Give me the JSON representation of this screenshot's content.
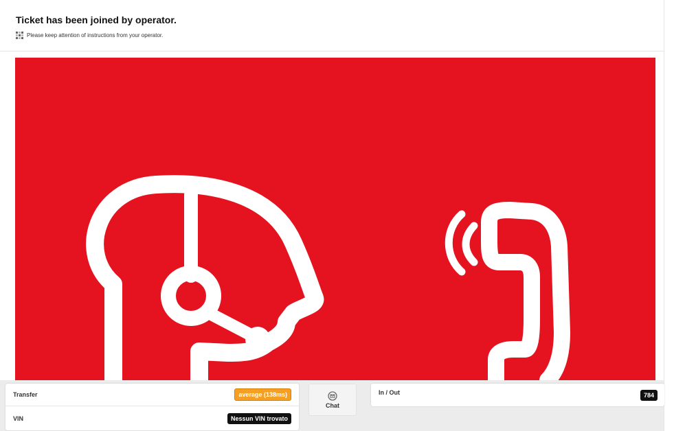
{
  "header": {
    "title": "Ticket has been joined by operator.",
    "subtitle": "Please keep attention of instructions from your operator.",
    "subtitle_icon": "grid-dots-icon"
  },
  "stage": {
    "background_color": "#e5131f",
    "illustration": [
      "operator-headset-icon",
      "phone-handset-ringing-icon"
    ]
  },
  "bottom": {
    "transfer_label": "Transfer",
    "transfer_value": "average (138ms)",
    "transfer_value_color": "#f4a024",
    "vin_label": "VIN",
    "vin_value": "Nessun VIN trovato",
    "chat_label": "Chat",
    "chat_icon": "envelope-icon",
    "inout_label": "In / Out",
    "inout_value": "784"
  }
}
